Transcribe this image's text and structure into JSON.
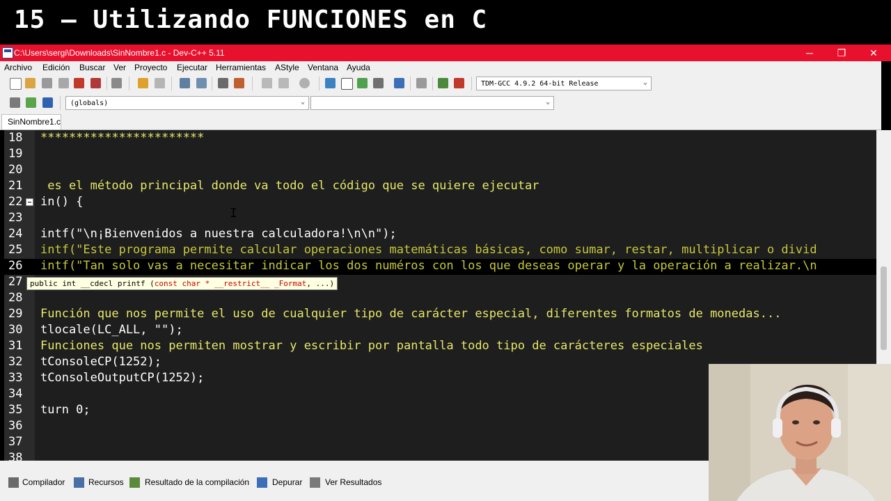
{
  "banner": {
    "title": "15 – Utilizando FUNCIONES en C"
  },
  "window": {
    "title": "C:\\Users\\sergi\\Downloads\\SinNombre1.c - Dev-C++ 5.11",
    "minimize": "─",
    "restore": "❐",
    "close": "✕"
  },
  "menu": [
    "Archivo",
    "Edición",
    "Buscar",
    "Ver",
    "Proyecto",
    "Ejecutar",
    "Herramientas",
    "AStyle",
    "Ventana",
    "Ayuda"
  ],
  "toolbar": {
    "compiler_select": "TDM-GCC 4.9.2 64-bit Release",
    "scope_select": "(globals)",
    "member_select": ""
  },
  "tabs": {
    "file_tab": "SinNombre1.c"
  },
  "editor": {
    "lines": [
      {
        "num": "18",
        "text": "***********************"
      },
      {
        "num": "19",
        "text": ""
      },
      {
        "num": "20",
        "text": ""
      },
      {
        "num": "21",
        "text": " es el método principal donde va todo el código que se quiere ejecutar"
      },
      {
        "num": "22",
        "text": "in() {"
      },
      {
        "num": "23",
        "text": ""
      },
      {
        "num": "24",
        "text": "intf(\"\\n¡Bienvenidos a nuestra calculadora!\\n\\n\");"
      },
      {
        "num": "25",
        "text": "intf(\"Este programa permite calcular operaciones matemáticas básicas, como sumar, restar, multiplicar o divid"
      },
      {
        "num": "26",
        "text": "intf(\"Tan solo vas a necesitar indicar los dos numéros con los que deseas operar y la operación a realizar.\\n"
      },
      {
        "num": "27",
        "text": ""
      },
      {
        "num": "28",
        "text": ""
      },
      {
        "num": "29",
        "text": "Función que nos permite el uso de cualquier tipo de carácter especial, diferentes formatos de monedas..."
      },
      {
        "num": "30",
        "text": "tlocale(LC_ALL, \"\");"
      },
      {
        "num": "31",
        "text": "Funciones que nos permiten mostrar y escribir por pantalla todo tipo de carácteres especiales"
      },
      {
        "num": "32",
        "text": "tConsoleCP(1252);"
      },
      {
        "num": "33",
        "text": "tConsoleOutputCP(1252);"
      },
      {
        "num": "34",
        "text": ""
      },
      {
        "num": "35",
        "text": "turn 0;"
      },
      {
        "num": "36",
        "text": ""
      },
      {
        "num": "37",
        "text": ""
      },
      {
        "num": "38",
        "text": ""
      }
    ],
    "tooltip": {
      "prefix": "public int __cdecl printf (",
      "highlight": "const char * __restrict__ _Format",
      "suffix": ", ...)"
    }
  },
  "bottom_tabs": [
    "Compilador",
    "Recursos",
    "Resultado de la compilación",
    "Depurar",
    "Ver Resultados"
  ]
}
